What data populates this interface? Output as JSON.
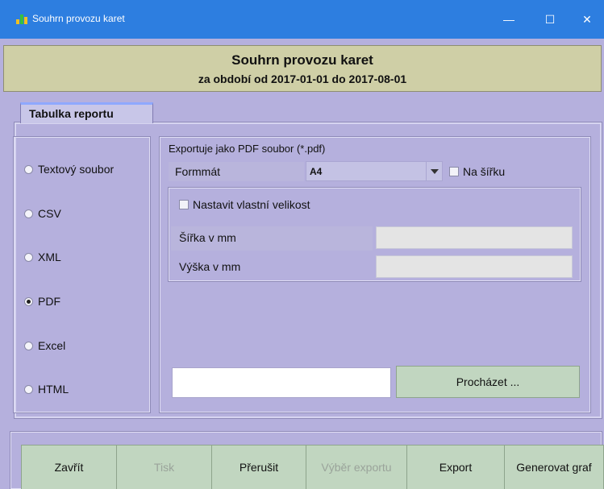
{
  "window": {
    "title": "Souhrn provozu karet",
    "minimize_symbol": "—",
    "maximize_symbol": "☐",
    "close_symbol": "✕"
  },
  "banner": {
    "title": "Souhrn provozu karet",
    "subtitle": "za období od 2017-01-01 do 2017-08-01"
  },
  "tab": {
    "label": "Tabulka reportu"
  },
  "formats": [
    {
      "label": "Textový soubor",
      "selected": false
    },
    {
      "label": "CSV",
      "selected": false
    },
    {
      "label": "XML",
      "selected": false
    },
    {
      "label": "PDF",
      "selected": true
    },
    {
      "label": "Excel",
      "selected": false
    },
    {
      "label": "HTML",
      "selected": false
    }
  ],
  "export": {
    "hint": "Exportuje jako PDF soubor (*.pdf)",
    "format_label": "Formmát",
    "format_value": "A4",
    "landscape_label": "Na šířku",
    "landscape_checked": false,
    "custom_size_label": "Nastavit vlastní velikost",
    "custom_size_checked": false,
    "width_label": "Šířka v mm",
    "width_value": "",
    "height_label": "Výška v mm",
    "height_value": "",
    "path_value": "",
    "browse_label": "Procházet ..."
  },
  "buttons": [
    {
      "label": "Zavřít",
      "enabled": true
    },
    {
      "label": "Tisk",
      "enabled": false
    },
    {
      "label": "Přerušit",
      "enabled": true
    },
    {
      "label": "Výběr exportu",
      "enabled": false
    },
    {
      "label": "Export",
      "enabled": true
    },
    {
      "label": "Generovat graf",
      "enabled": true
    }
  ],
  "colors": {
    "titlebar": "#2d7ee0",
    "panel": "#b5b0dd",
    "banner": "#cfcfa6",
    "button": "#c1d6c0"
  }
}
